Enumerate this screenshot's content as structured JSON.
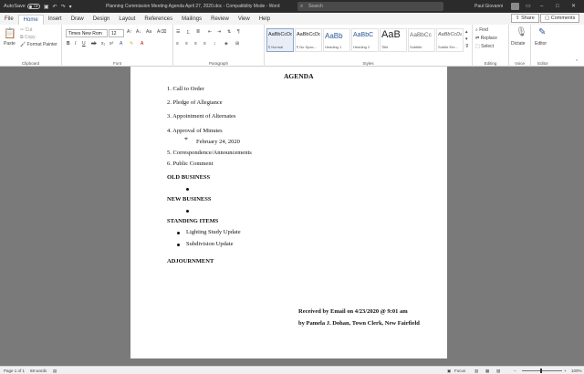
{
  "titlebar": {
    "autosave_label": "AutoSave",
    "autosave_state": "Off",
    "document_title": "Planning Commission Meeting Agenda April 27, 2020.doc  -  Compatibility Mode  -  Word",
    "search_placeholder": "Search",
    "user_name": "Paul Giovanni"
  },
  "tabs": [
    "File",
    "Home",
    "Insert",
    "Draw",
    "Design",
    "Layout",
    "References",
    "Mailings",
    "Review",
    "View",
    "Help"
  ],
  "tab_actions": {
    "share": "Share",
    "comments": "Comments"
  },
  "clipboard": {
    "paste": "Paste",
    "cut": "Cut",
    "copy": "Copy",
    "format_painter": "Format Painter",
    "label": "Clipboard"
  },
  "font": {
    "name": "Times New Rom",
    "size": "12",
    "label": "Font"
  },
  "paragraph": {
    "label": "Paragraph"
  },
  "styles": {
    "label": "Styles",
    "items": [
      {
        "sample": "AaBbCcDd",
        "name": "¶ Normal"
      },
      {
        "sample": "AaBbCcDd",
        "name": "¶ No Spac..."
      },
      {
        "sample": "AaBb",
        "name": "Heading 1"
      },
      {
        "sample": "AaBbC",
        "name": "Heading 2"
      },
      {
        "sample": "AaB",
        "name": "Title"
      },
      {
        "sample": "AaBbCc",
        "name": "Subtitle"
      },
      {
        "sample": "AaBbCcDa",
        "name": "Subtle Em..."
      }
    ]
  },
  "editing": {
    "find": "Find",
    "replace": "Replace",
    "select": "Select",
    "label": "Editing"
  },
  "voice": {
    "dictate": "Dictate",
    "label": "Voice"
  },
  "editor": {
    "editor": "Editor",
    "label": "Editor"
  },
  "document": {
    "heading": "AGENDA",
    "items": [
      "1.  Call to Order",
      "2.  Pledge of Allegiance",
      "3.  Appointment of Alternates",
      "4.  Approval of Minutes",
      "5.  Correspondence/Announcements",
      "6.  Public Comment"
    ],
    "minutes_date": "February 24, 2020",
    "old_business": "OLD BUSINESS",
    "new_business": "NEW BUSINESS",
    "standing_items": "STANDING ITEMS",
    "standing_list": [
      "Lighting Study Update",
      "Subdivision Update"
    ],
    "adjournment": "ADJOURNMENT",
    "received": "Received by Email on 4/23/2020 @ 9:01 am",
    "clerk": "by Pamela J. Dohan, Town Clerk, New Fairfield"
  },
  "statusbar": {
    "page": "Page 1 of 1",
    "words": "68 words",
    "focus": "Focus",
    "zoom": "100%"
  }
}
